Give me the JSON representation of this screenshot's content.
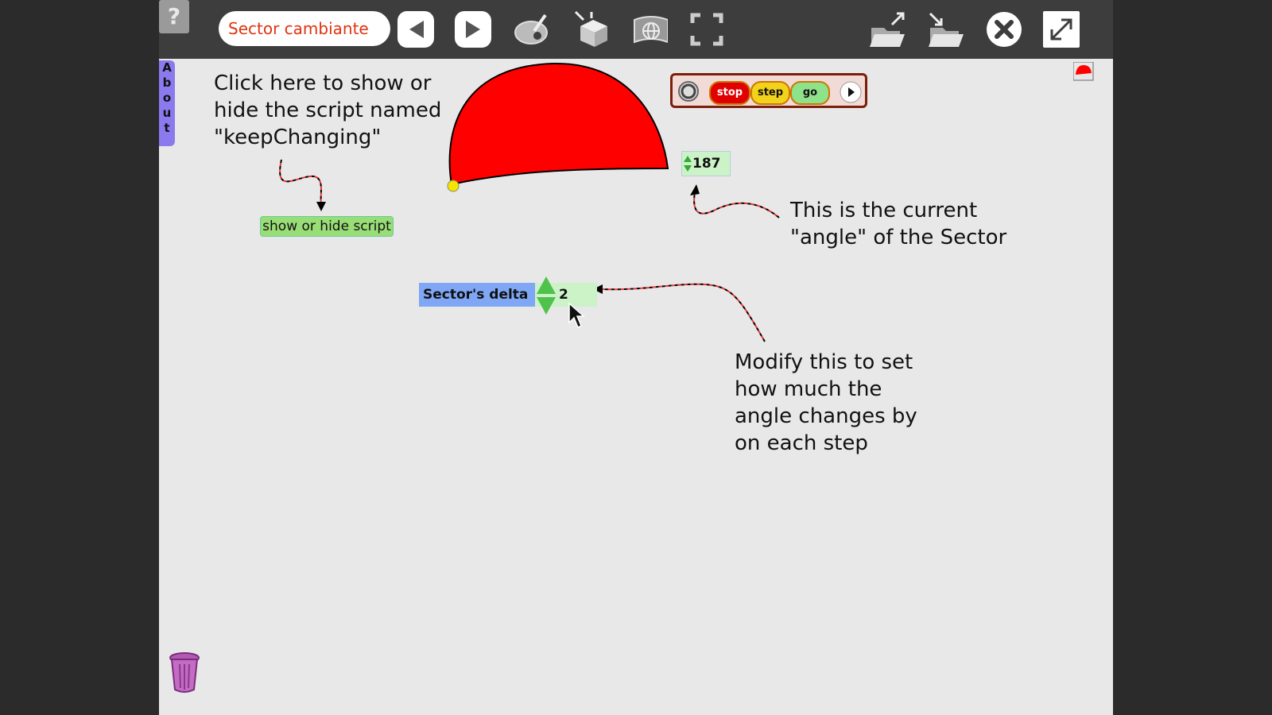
{
  "toolbar": {
    "help_label": "?",
    "project_title": "Sector cambiante",
    "buttons": [
      "previous-page",
      "next-page",
      "paint",
      "supplies",
      "world",
      "fullscreen-view",
      "open-project",
      "save-project",
      "close",
      "expand"
    ]
  },
  "about_tab": {
    "letters": [
      "A",
      "b",
      "o",
      "u",
      "t"
    ]
  },
  "notes": {
    "script_note": "Click here to show or\nhide the script named\n\"keepChanging\"",
    "angle_note": "This is the current\n\"angle\" of the Sector",
    "delta_note": "Modify this to set\nhow much the\nangle changes by\non each step"
  },
  "show_hide_button": "show or hide script",
  "flap": {
    "stop": "stop",
    "step": "step",
    "go": "go"
  },
  "angle_value": "187",
  "delta": {
    "label": "Sector's delta",
    "value": "2"
  },
  "colors": {
    "sector": "#ff0000",
    "accent_title": "#e0330f",
    "stop": "#e10000",
    "step": "#f2d21a",
    "go": "#8ee28a"
  }
}
